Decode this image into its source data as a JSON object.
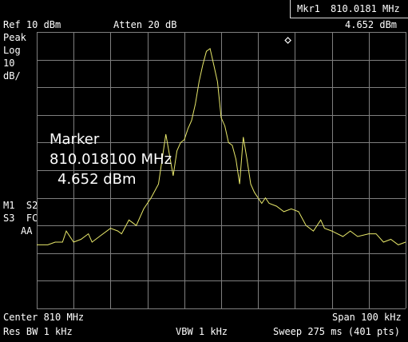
{
  "header": {
    "ref_level": "Ref 10 dBm",
    "attenuation": "Atten 20 dB",
    "marker_readout": {
      "label": "Mkr1",
      "frequency": "810.0181 MHz",
      "amplitude": "4.652 dBm"
    }
  },
  "left_panel": {
    "detector": "Peak",
    "scale_type": "Log",
    "scale_value": "10",
    "scale_unit": "dB/",
    "status_lines": [
      "M1  S2",
      "S3  FC",
      "AA"
    ]
  },
  "marker_annotation": {
    "title": "Marker",
    "frequency": "810.018100 MHz",
    "amplitude": "4.652 dBm"
  },
  "footer": {
    "center": "Center 810 MHz",
    "span": "Span 100 kHz",
    "rbw": "Res BW 1 kHz",
    "vbw": "VBW 1 kHz",
    "sweep": "Sweep 275 ms (401 pts)"
  },
  "colors": {
    "background": "#000000",
    "grid": "#7f7f7f",
    "trace": "#e8e86a",
    "text": "#ffffff"
  },
  "chart_data": {
    "type": "line",
    "center_mhz": 810,
    "span_khz": 100,
    "ref_level_dbm": 10,
    "scale_db_per_div": 10,
    "divisions_x": 10,
    "divisions_y": 10,
    "marker": {
      "frequency_mhz": 810.0181,
      "amplitude_dbm": 4.652,
      "symbol": "diamond"
    },
    "series": [
      {
        "name": "",
        "x_offset_khz": [
          -50,
          -47,
          -45,
          -43,
          -42,
          -40,
          -38,
          -36,
          -35,
          -33,
          -30,
          -28,
          -27,
          -25,
          -23,
          -21,
          -19,
          -17,
          -15,
          -13,
          -12,
          -11,
          -10,
          -9,
          -8,
          -7,
          -6,
          -5,
          -4,
          -3,
          -2,
          -1,
          0,
          1,
          2,
          3,
          4,
          5,
          6,
          7,
          8,
          9,
          10,
          11,
          12,
          13,
          15,
          17,
          19,
          21,
          23,
          25,
          27,
          28,
          30,
          33,
          35,
          37,
          40,
          42,
          44,
          46,
          48,
          50
        ],
        "amplitude_dbm": [
          -67,
          -67,
          -66,
          -66,
          -62,
          -66,
          -65,
          -63,
          -66,
          -64,
          -61,
          -62,
          -63,
          -58,
          -60,
          -54,
          -50,
          -45,
          -27,
          -42,
          -33,
          -30,
          -29,
          -25,
          -22,
          -16,
          -8,
          -2,
          3,
          4,
          -2,
          -8,
          -21,
          -24,
          -30,
          -31,
          -36,
          -45,
          -28,
          -36,
          -45,
          -48,
          -50,
          -52,
          -50,
          -52,
          -53,
          -55,
          -54,
          -55,
          -60,
          -62,
          -58,
          -61,
          -62,
          -64,
          -62,
          -64,
          -63,
          -63,
          -66,
          -65,
          -67,
          -66
        ]
      }
    ]
  }
}
